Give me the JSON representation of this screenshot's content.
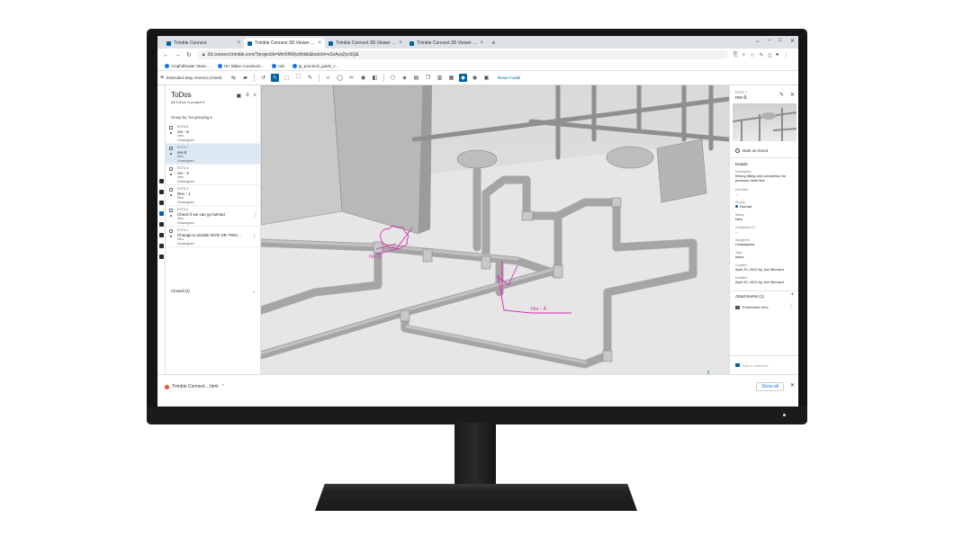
{
  "browser": {
    "tabs": [
      {
        "label": "Trimble Connect",
        "active": false
      },
      {
        "label": "Trimble Connect 3D Viewer - Ext…",
        "active": true
      },
      {
        "label": "Trimble Connect 3D Viewer - M…",
        "active": false
      },
      {
        "label": "Trimble Connect 3D Viewer - M…",
        "active": false
      }
    ],
    "url": "3d.connect.trimble.com/?projectId=Mm5NWyo8dsk&todoId=vSvAyq2yc5Q&",
    "bookmarks": [
      "Amphitheater Stairc…",
      "HC Blake Constructi…",
      "rain",
      "gt_practical_guide_t…"
    ]
  },
  "app": {
    "project": "Extended Stay America (Hotel)",
    "reset_label": "Reset model"
  },
  "todos": {
    "title": "ToDos",
    "subtitle": "All ToDos in project",
    "group_by": "Group by: No grouping",
    "items": [
      {
        "id": "EXTS-6",
        "title": "rev - 5",
        "status": "New",
        "assignee": "Unassigned"
      },
      {
        "id": "EXTS-7",
        "title": "rev-5",
        "status": "New",
        "assignee": "Unassigned"
      },
      {
        "id": "EXTS-4",
        "title": "rev - 4",
        "status": "New",
        "assignee": "Unassigned"
      },
      {
        "id": "EXTS-3",
        "title": "Rev - 1",
        "status": "New",
        "assignee": "Unassigned"
      },
      {
        "id": "EXTS-2",
        "title": "Check if we can go behind",
        "status": "New",
        "assignee": "Unassigned"
      },
      {
        "id": "EXTS-1",
        "title": "Change to double WYE OR TWO…",
        "status": "New",
        "assignee": "Unassigned"
      }
    ],
    "closed_label": "Closed (2)"
  },
  "viewport": {
    "markup_labels": [
      "rev-5",
      "rev - 4"
    ]
  },
  "details": {
    "id": "EXTS-7",
    "title": "rev-5",
    "mark_closed": "Mark as closed",
    "section": "Details",
    "fields": [
      {
        "label": "Description",
        "value": "Wrong fitting and connection for pressure relief line."
      },
      {
        "label": "Due date",
        "value": "--"
      },
      {
        "label": "Priority",
        "value": "Normal"
      },
      {
        "label": "Status",
        "value": "New"
      },
      {
        "label": "Completion %",
        "value": "--"
      },
      {
        "label": "Assignees",
        "value": "Unassigned"
      },
      {
        "label": "Type",
        "value": "Issue"
      },
      {
        "label": "Created",
        "value": "April 20, 2022 by Joel Bernard"
      },
      {
        "label": "Modified",
        "value": "April 20, 2022 by Joel Bernard"
      }
    ],
    "attachments_label": "Attachments (1)",
    "attachment": "Embedded view",
    "comment_placeholder": "Add a comment..."
  },
  "downloads": {
    "file": "Trimble Connect....html",
    "show_all": "Show all"
  },
  "colors": {
    "accent": "#0063a3",
    "markup": "#d62fb0",
    "pipe": "#a9a9a9"
  }
}
